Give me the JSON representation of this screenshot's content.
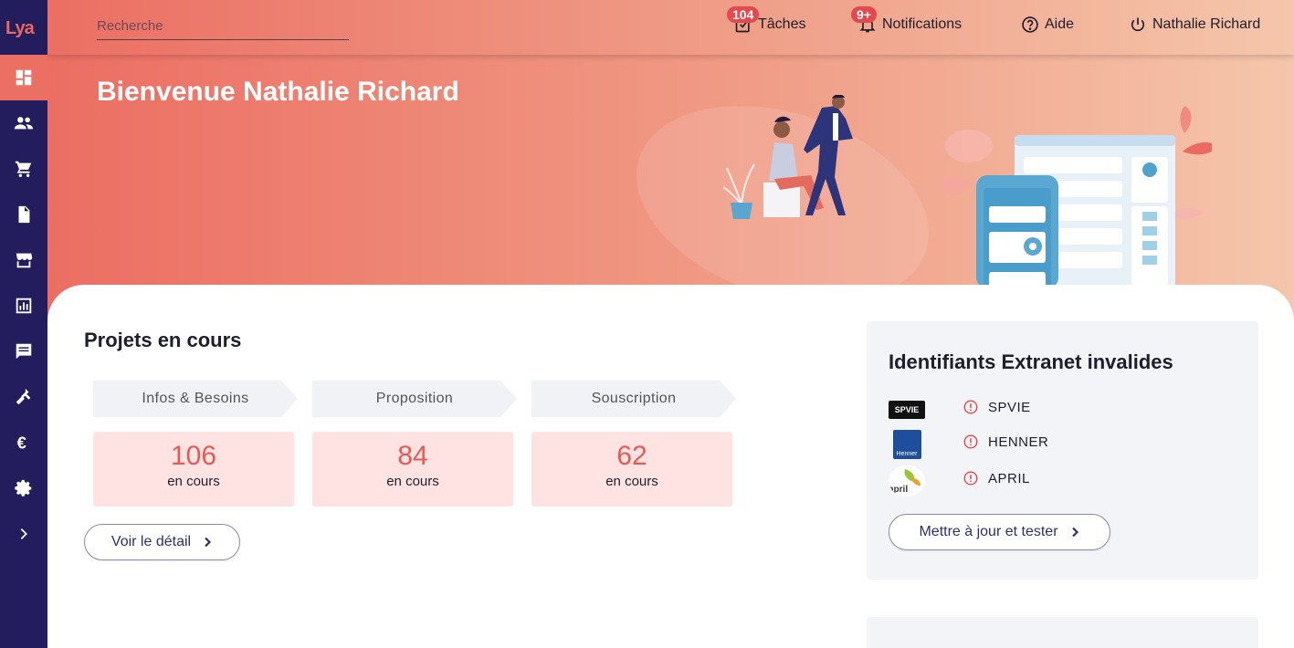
{
  "brand": {
    "logo_text": "Lya"
  },
  "search": {
    "placeholder": "Recherche"
  },
  "topbar": {
    "tasks": {
      "label": "Tâches",
      "badge": "104"
    },
    "notifications": {
      "label": "Notifications",
      "badge": "9+"
    },
    "help": {
      "label": "Aide"
    },
    "user": {
      "label": "Nathalie Richard"
    }
  },
  "sidebar": {
    "items": [
      {
        "icon": "dashboard-icon",
        "active": true
      },
      {
        "icon": "people-icon"
      },
      {
        "icon": "cart-icon"
      },
      {
        "icon": "document-icon"
      },
      {
        "icon": "store-icon"
      },
      {
        "icon": "chart-icon"
      },
      {
        "icon": "message-icon"
      },
      {
        "icon": "tools-icon"
      },
      {
        "icon": "euro-icon"
      },
      {
        "icon": "settings-icon"
      },
      {
        "icon": "chevron-right-icon"
      }
    ]
  },
  "hero": {
    "welcome": "Bienvenue Nathalie Richard"
  },
  "projects": {
    "title": "Projets en cours",
    "steps": [
      {
        "label": "Infos & Besoins",
        "count": "106",
        "sub": "en cours"
      },
      {
        "label": "Proposition",
        "count": "84",
        "sub": "en cours"
      },
      {
        "label": "Souscription",
        "count": "62",
        "sub": "en cours"
      }
    ],
    "detail_button": "Voir le détail"
  },
  "extranet": {
    "title": "Identifiants Extranet invalides",
    "items": [
      {
        "name": "SPVIE",
        "logo_text": "SPVIE"
      },
      {
        "name": "HENNER",
        "logo_text": "Henner"
      },
      {
        "name": "APRIL",
        "logo_text": "april"
      }
    ],
    "button": "Mettre à jour et tester"
  },
  "colors": {
    "sidebar": "#231d5e",
    "accent": "#eb6f63",
    "badge": "#e5484d",
    "stat_bg": "#ffe3e3",
    "stat_num": "#e65a56",
    "warning": "#e5484d"
  }
}
